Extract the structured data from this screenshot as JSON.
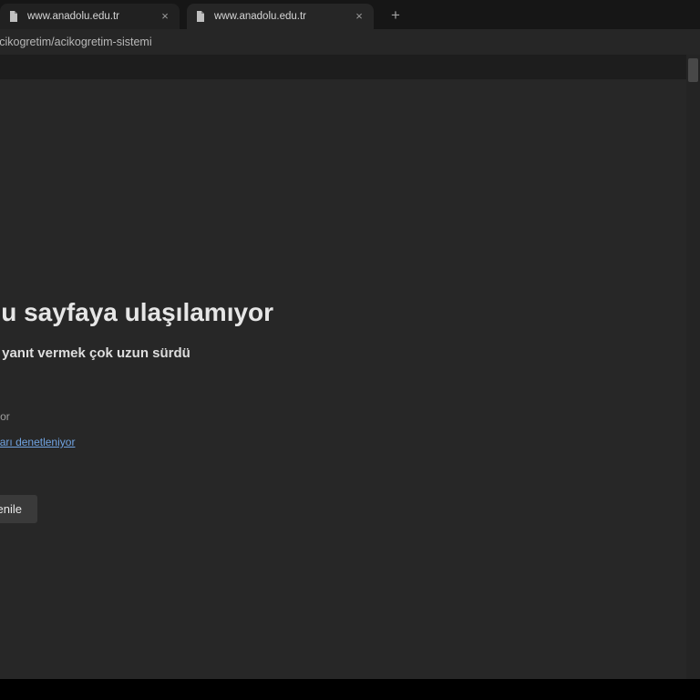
{
  "browser": {
    "tabs": [
      {
        "title": "www.anadolu.edu.tr"
      },
      {
        "title": "www.anadolu.edu.tr"
      }
    ],
    "tab_close_glyph": "×",
    "new_tab_glyph": "+",
    "url": "www.anadolu.edu.tr/acikogretim/acikogretim-sistemi"
  },
  "error_page": {
    "title": "Bu sayfaya ulaşılamıyor",
    "subtitle": "www.anadolu.edu.tr yanıt vermek çok uzun sürdü",
    "checking_connection": "Bağlantı denetleniyor",
    "checking_proxy_and_firewall": "Proxy ve güvenlik duvarı denetleniyor",
    "refresh_button": "Yenile"
  },
  "colors": {
    "link": "#70a3e0",
    "content_background": "#272727",
    "button_background": "#3a3a3a"
  }
}
